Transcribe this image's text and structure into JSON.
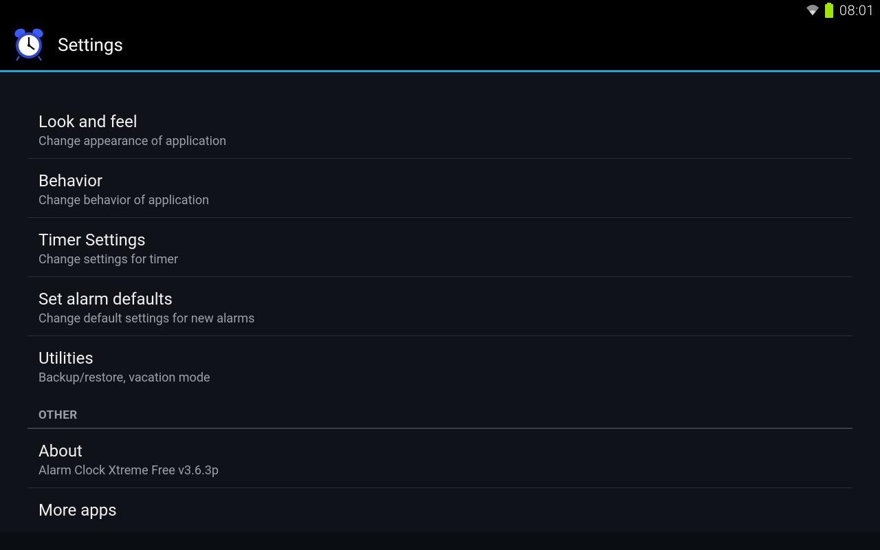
{
  "status": {
    "time": "08:01"
  },
  "app": {
    "title": "Settings"
  },
  "settings": {
    "items": [
      {
        "title": "Look and feel",
        "sub": "Change appearance of application"
      },
      {
        "title": "Behavior",
        "sub": "Change behavior of application"
      },
      {
        "title": "Timer Settings",
        "sub": "Change settings for timer"
      },
      {
        "title": "Set alarm defaults",
        "sub": "Change default settings for new alarms"
      },
      {
        "title": "Utilities",
        "sub": "Backup/restore, vacation mode"
      }
    ],
    "section_other": "OTHER",
    "other_items": [
      {
        "title": "About",
        "sub": "Alarm Clock Xtreme Free v3.6.3p"
      },
      {
        "title": "More apps",
        "sub": ""
      }
    ]
  },
  "colors": {
    "accent": "#1fa7d8",
    "battery": "#9fe600",
    "wifi": "#b0b0b0"
  }
}
